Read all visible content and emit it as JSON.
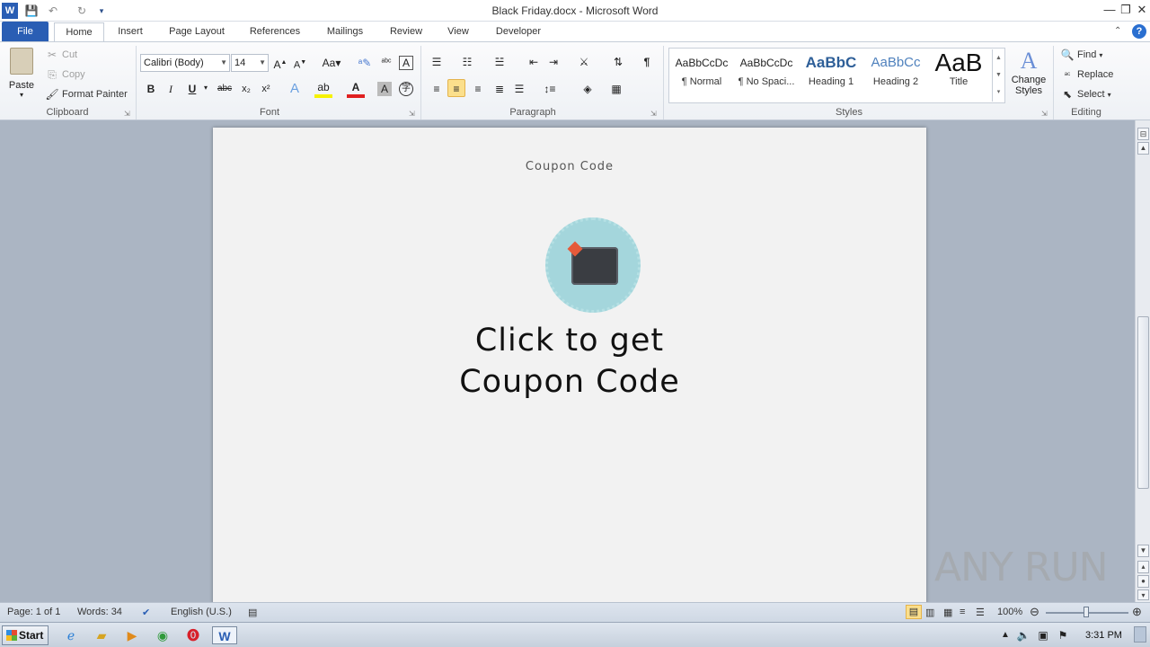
{
  "window": {
    "title": "Black Friday.docx  -  Microsoft Word",
    "app_icon": "word-icon"
  },
  "tabs": [
    "File",
    "Home",
    "Insert",
    "Page Layout",
    "References",
    "Mailings",
    "Review",
    "View",
    "Developer"
  ],
  "ribbon": {
    "clipboard": {
      "paste": "Paste",
      "cut": "Cut",
      "copy": "Copy",
      "format_painter": "Format Painter",
      "label": "Clipboard"
    },
    "font": {
      "family": "Calibri (Body)",
      "size": "14",
      "label": "Font",
      "bold": "B",
      "italic": "I",
      "underline": "U",
      "strike": "abc",
      "subscript": "x₂",
      "superscript": "x²",
      "case": "Aa"
    },
    "paragraph": {
      "label": "Paragraph"
    },
    "styles": {
      "label": "Styles",
      "items": [
        {
          "preview": "AaBbCcDc",
          "name": "¶ Normal"
        },
        {
          "preview": "AaBbCcDc",
          "name": "¶ No Spaci..."
        },
        {
          "preview": "AaBbC",
          "name": "Heading 1"
        },
        {
          "preview": "AaBbCc",
          "name": "Heading 2"
        },
        {
          "preview": "AaB",
          "name": "Title"
        }
      ],
      "change_styles": "Change Styles"
    },
    "editing": {
      "find": "Find",
      "replace": "Replace",
      "select": "Select",
      "label": "Editing"
    }
  },
  "document": {
    "header_text": "Coupon Code",
    "cta_line1": "Click to get",
    "cta_line2": "Coupon Code"
  },
  "status": {
    "page": "Page: 1 of 1",
    "words": "Words: 34",
    "language": "English (U.S.)",
    "zoom": "100%"
  },
  "taskbar": {
    "start": "Start",
    "clock": "3:31 PM"
  },
  "watermark": "ANY RUN",
  "colors": {
    "accent": "#2a5eb4",
    "badge": "#a4d6dc",
    "page": "#f2f2f2"
  }
}
